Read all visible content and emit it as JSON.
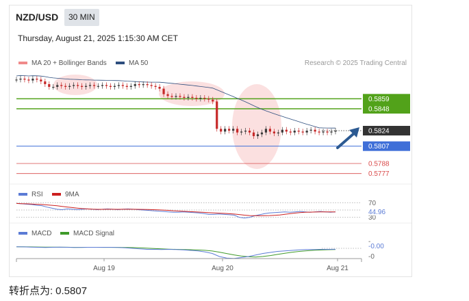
{
  "header": {
    "symbol": "NZD/USD",
    "timeframe": "30 MIN",
    "datetime": "Thursday, August 21, 2025 1:15:30 AM CET"
  },
  "legend_main": [
    {
      "label": "MA 20 + Bollinger Bands",
      "color": "#f08a8a"
    },
    {
      "label": "MA 50",
      "color": "#2d4e7e"
    }
  ],
  "credit": "Research © 2025 Trading Central",
  "footer": {
    "label": "转折点为:",
    "value": "0.5807"
  },
  "colors": {
    "bull": "#3a3a3a",
    "bear": "#c62828",
    "target": "#52a21a",
    "pivot": "#3f6fd8",
    "support": "#d94a4a",
    "current": "#333333",
    "arrow": "#2c5a92"
  },
  "chart_data": [
    {
      "type": "line",
      "name": "price",
      "x_ticks": [
        "Aug 19",
        "Aug 20",
        "Aug 21"
      ],
      "ylim": [
        0.577,
        0.589
      ],
      "levels": {
        "target_1": 0.5859,
        "target_2": 0.5848,
        "current": 0.5824,
        "pivot": 0.5807,
        "support_1": 0.5788,
        "support_2": 0.5777
      },
      "level_labels": [
        "0.5859",
        "0.5848",
        "0.5824",
        "0.5807",
        "0.5788",
        "0.5777"
      ],
      "close": [
        0.588,
        0.5881,
        0.588,
        0.5879,
        0.5881,
        0.588,
        0.5878,
        0.5875,
        0.5872,
        0.5872,
        0.5874,
        0.5873,
        0.5872,
        0.5873,
        0.5874,
        0.5873,
        0.5872,
        0.5873,
        0.5874,
        0.5873,
        0.5873,
        0.5874,
        0.5873,
        0.5872,
        0.5873,
        0.5874,
        0.5873,
        0.5872,
        0.5873,
        0.5875,
        0.5874,
        0.5875,
        0.5874,
        0.5873,
        0.5872,
        0.587,
        0.5864,
        0.5862,
        0.5861,
        0.5862,
        0.5861,
        0.586,
        0.5861,
        0.586,
        0.5859,
        0.586,
        0.5859,
        0.5858,
        0.5856,
        0.5826,
        0.5823,
        0.5826,
        0.5824,
        0.5826,
        0.5822,
        0.5823,
        0.5824,
        0.5822,
        0.5818,
        0.582,
        0.5822,
        0.5826,
        0.5823,
        0.5821,
        0.5822,
        0.5825,
        0.5823,
        0.5822,
        0.5824,
        0.5823,
        0.5822,
        0.5824,
        0.5825,
        0.5823,
        0.5822,
        0.5823,
        0.5822,
        0.5823,
        0.5824
      ]
    },
    {
      "type": "line",
      "name": "RSI",
      "legend": [
        "RSI",
        "9MA"
      ],
      "legend_colors": [
        "#5b7bd5",
        "#cc1f1f"
      ],
      "levels": [
        70,
        50,
        30
      ],
      "level_labels": [
        "70",
        "30"
      ],
      "current_label": "44.96",
      "ylim": [
        20,
        80
      ],
      "rsi": [
        68,
        67,
        66,
        65,
        63,
        62,
        58,
        55,
        52,
        51,
        53,
        52,
        51,
        52,
        53,
        52,
        51,
        52,
        53,
        52,
        51,
        52,
        53,
        52,
        51,
        50,
        49,
        48,
        47,
        46,
        45,
        44,
        44,
        45,
        44,
        43,
        42,
        40,
        38,
        38,
        39,
        38,
        37,
        36,
        30,
        28,
        30,
        34,
        37,
        40,
        42,
        43,
        44,
        45,
        44,
        45,
        46,
        45,
        44,
        45,
        46,
        45,
        44,
        45
      ]
    },
    {
      "type": "line",
      "name": "MACD",
      "legend": [
        "MACD",
        "MACD Signal"
      ],
      "legend_colors": [
        "#5b7bd5",
        "#3f9a2a"
      ],
      "label_top": "-",
      "current_label": "-0.00",
      "label_bottom": "-0",
      "ylim": [
        -1,
        1
      ],
      "macd": [
        0.15,
        0.14,
        0.12,
        0.1,
        0.08,
        0.1,
        0.12,
        0.1,
        0.08,
        0.09,
        0.1,
        0.1,
        0.1,
        0.1,
        0.08,
        0.05,
        0.0,
        -0.05,
        -0.1,
        -0.1,
        -0.12,
        -0.1,
        -0.12,
        -0.15,
        -0.2,
        -0.25,
        -0.35,
        -0.5,
        -0.8,
        -0.95,
        -0.98,
        -0.9,
        -0.8,
        -0.65,
        -0.5,
        -0.4,
        -0.3,
        -0.25,
        -0.2,
        -0.15,
        -0.12,
        -0.12,
        -0.1,
        -0.1,
        -0.09
      ]
    }
  ]
}
